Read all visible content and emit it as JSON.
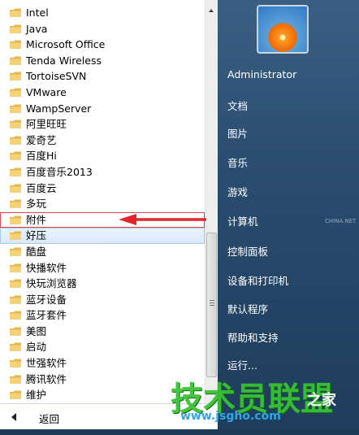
{
  "programs": [
    {
      "label": "Intel"
    },
    {
      "label": "Java"
    },
    {
      "label": "Microsoft Office"
    },
    {
      "label": "Tenda Wireless"
    },
    {
      "label": "TortoiseSVN"
    },
    {
      "label": "VMware"
    },
    {
      "label": "WampServer"
    },
    {
      "label": "阿里旺旺"
    },
    {
      "label": "爱奇艺"
    },
    {
      "label": "百度Hi"
    },
    {
      "label": "百度音乐2013"
    },
    {
      "label": "百度云"
    },
    {
      "label": "多玩"
    },
    {
      "label": "附件"
    },
    {
      "label": "好压"
    },
    {
      "label": "酷盘"
    },
    {
      "label": "快播软件"
    },
    {
      "label": "快玩浏览器"
    },
    {
      "label": "蓝牙设备"
    },
    {
      "label": "蓝牙套件"
    },
    {
      "label": "美图"
    },
    {
      "label": "启动"
    },
    {
      "label": "世强软件"
    },
    {
      "label": "腾讯软件"
    },
    {
      "label": "维护"
    }
  ],
  "back_label": "返回",
  "right_menu": {
    "user": "Administrator",
    "items": [
      {
        "label": "文档"
      },
      {
        "label": "图片"
      },
      {
        "label": "音乐"
      },
      {
        "label": "游戏"
      },
      {
        "label": "计算机"
      },
      {
        "label": "控制面板"
      },
      {
        "label": "设备和打印机"
      },
      {
        "label": "默认程序"
      },
      {
        "label": "帮助和支持"
      },
      {
        "label": "运行..."
      }
    ]
  },
  "watermark": {
    "main": "技术员联盟",
    "suffix": "之家",
    "url": "www.jsgho.com",
    "small": "CHINA.NET"
  },
  "colors": {
    "folder": "#e6b84a",
    "highlight_box": "#e0484a",
    "arrow": "#e2262b",
    "watermark_green": "#39c235"
  }
}
